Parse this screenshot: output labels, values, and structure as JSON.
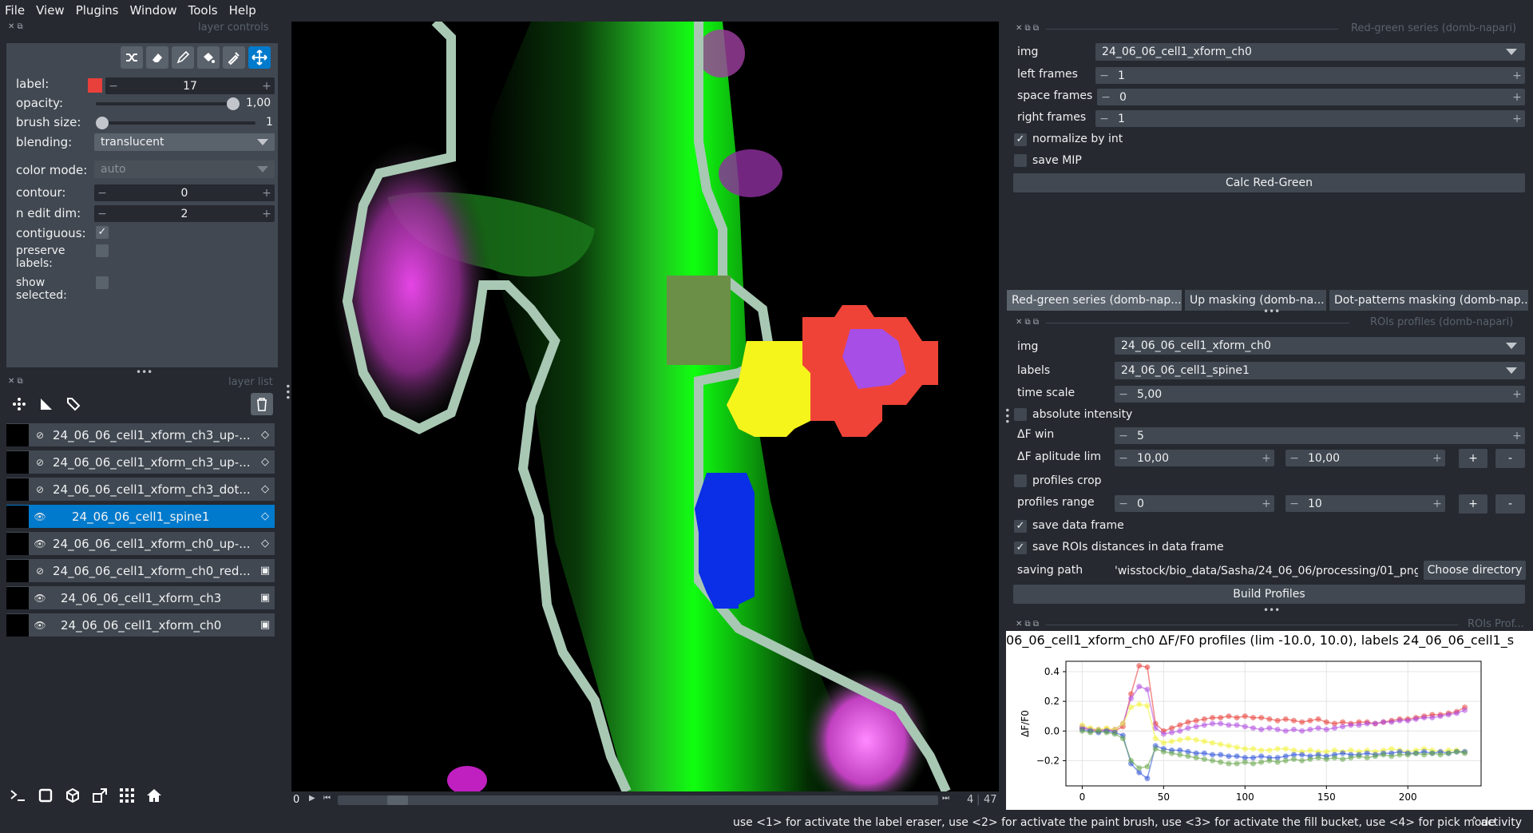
{
  "menu": [
    "File",
    "View",
    "Plugins",
    "Window",
    "Tools",
    "Help"
  ],
  "layer_controls": {
    "title": "layer controls",
    "label_label": "label:",
    "label_value": "17",
    "label_color": "#e8403a",
    "opacity_label": "opacity:",
    "opacity_value": "1,00",
    "opacity_level": 1.0,
    "brush_label": "brush size:",
    "brush_value": "1",
    "brush_level": 0.0,
    "blending_label": "blending:",
    "blending_value": "translucent",
    "colormode_label": "color mode:",
    "colormode_value": "auto",
    "contour_label": "contour:",
    "contour_value": "0",
    "nedit_label": "n edit dim:",
    "nedit_value": "2",
    "contiguous_label": "contiguous:",
    "preserve_label_1": "preserve",
    "preserve_label_2": "labels:",
    "show_label_1": "show",
    "show_label_2": "selected:"
  },
  "layer_list": {
    "title": "layer list",
    "layers": [
      {
        "name": "24_06_06_cell1_xform_ch3_up-...",
        "visible": false,
        "type": "labels-icon"
      },
      {
        "name": "24_06_06_cell1_xform_ch3_up-...",
        "visible": false,
        "type": "labels-icon"
      },
      {
        "name": "24_06_06_cell1_xform_ch3_dot...",
        "visible": false,
        "type": "labels-icon"
      },
      {
        "name": "24_06_06_cell1_spine1",
        "visible": true,
        "type": "labels-icon"
      },
      {
        "name": "24_06_06_cell1_xform_ch0_up-...",
        "visible": true,
        "type": "labels-icon"
      },
      {
        "name": "24_06_06_cell1_xform_ch0_red...",
        "visible": false,
        "type": "image-icon"
      },
      {
        "name": "24_06_06_cell1_xform_ch3",
        "visible": true,
        "type": "image-icon"
      },
      {
        "name": "24_06_06_cell1_xform_ch0",
        "visible": true,
        "type": "image-icon"
      }
    ]
  },
  "viewer": {
    "frame_start": "0",
    "frame_current": "4",
    "frame_total": "47"
  },
  "redgreen": {
    "title": "Red-green series (domb-napari)",
    "img_label": "img",
    "img_value": "24_06_06_cell1_xform_ch0",
    "left_label": "left frames",
    "left_value": "1",
    "space_label": "space frames",
    "space_value": "0",
    "right_label": "right frames",
    "right_value": "1",
    "normalize_label": "normalize by int",
    "savemip_label": "save MIP",
    "calc_button": "Calc Red-Green"
  },
  "tabs": [
    "Red-green series (domb-nap...",
    "Up masking (domb-na...",
    "Dot-patterns masking (domb-nap..."
  ],
  "roi": {
    "title": "ROIs profiles (domb-napari)",
    "img_label": "img",
    "img_value": "24_06_06_cell1_xform_ch0",
    "labels_label": "labels",
    "labels_value": "24_06_06_cell1_spine1",
    "timescale_label": "time scale",
    "timescale_value": "5,00",
    "absint_label": "absolute intensity",
    "dfwin_label": "ΔF win",
    "dfwin_value": "5",
    "dflim_label": "ΔF aplitude lim",
    "dflim_min": "10,00",
    "dflim_max": "10,00",
    "crop_label": "profiles crop",
    "range_label": "profiles range",
    "range_min": "0",
    "range_max": "10",
    "savedf_label": "save data frame",
    "savedist_label": "save ROIs distances in data frame",
    "path_label": "saving path",
    "path_value": "'wisstock/bio_data/Sasha/24_06_06/processing/01_png",
    "choose_button": "Choose directory",
    "build_button": "Build Profiles"
  },
  "plot_panel_title": "ROIs Prof...",
  "chart_data": {
    "type": "line",
    "title": "06_06_cell1_xform_ch0 ΔF/F0 profiles (lim -10.0, 10.0), labels 24_06_06_cell1_s",
    "ylabel": "ΔF/F0",
    "xlabel": "",
    "xlim": [
      -10,
      245
    ],
    "ylim": [
      -0.37,
      0.47
    ],
    "xticks": [
      0,
      50,
      100,
      150,
      200
    ],
    "yticks": [
      -0.2,
      0.0,
      0.2,
      0.4
    ],
    "grid": true,
    "series": [
      {
        "color": "#e8403a",
        "x": [
          0,
          5,
          10,
          15,
          20,
          25,
          30,
          35,
          40,
          45,
          50,
          55,
          60,
          65,
          70,
          75,
          80,
          85,
          90,
          95,
          100,
          105,
          110,
          115,
          120,
          125,
          130,
          135,
          140,
          145,
          150,
          155,
          160,
          165,
          170,
          175,
          180,
          185,
          190,
          195,
          200,
          205,
          210,
          215,
          220,
          225,
          230,
          235
        ],
        "values": [
          0.02,
          0.01,
          0.0,
          0.01,
          0.0,
          0.03,
          0.25,
          0.44,
          0.43,
          0.05,
          0.0,
          0.02,
          0.04,
          0.06,
          0.07,
          0.08,
          0.09,
          0.09,
          0.1,
          0.09,
          0.1,
          0.09,
          0.09,
          0.08,
          0.07,
          0.08,
          0.07,
          0.06,
          0.07,
          0.08,
          0.06,
          0.05,
          0.06,
          0.05,
          0.06,
          0.06,
          0.05,
          0.06,
          0.07,
          0.08,
          0.08,
          0.09,
          0.1,
          0.11,
          0.11,
          0.12,
          0.13,
          0.16
        ]
      },
      {
        "color": "#b04ee0",
        "x": [
          0,
          5,
          10,
          15,
          20,
          25,
          30,
          35,
          40,
          45,
          50,
          55,
          60,
          65,
          70,
          75,
          80,
          85,
          90,
          95,
          100,
          105,
          110,
          115,
          120,
          125,
          130,
          135,
          140,
          145,
          150,
          155,
          160,
          165,
          170,
          175,
          180,
          185,
          190,
          195,
          200,
          205,
          210,
          215,
          220,
          225,
          230,
          235
        ],
        "values": [
          0.03,
          0.01,
          0.01,
          0.0,
          0.01,
          0.05,
          0.22,
          0.3,
          0.28,
          0.02,
          -0.02,
          -0.01,
          0.0,
          0.02,
          0.03,
          0.04,
          0.05,
          0.05,
          0.04,
          0.04,
          0.03,
          0.02,
          0.01,
          0.02,
          0.01,
          0.0,
          0.01,
          0.0,
          0.01,
          0.02,
          0.01,
          0.02,
          0.03,
          0.04,
          0.04,
          0.05,
          0.05,
          0.06,
          0.06,
          0.07,
          0.07,
          0.08,
          0.09,
          0.09,
          0.1,
          0.11,
          0.12,
          0.14
        ]
      },
      {
        "color": "#f2f23a",
        "x": [
          0,
          5,
          10,
          15,
          20,
          25,
          30,
          35,
          40,
          45,
          50,
          55,
          60,
          65,
          70,
          75,
          80,
          85,
          90,
          95,
          100,
          105,
          110,
          115,
          120,
          125,
          130,
          135,
          140,
          145,
          150,
          155,
          160,
          165,
          170,
          175,
          180,
          185,
          190,
          195,
          200,
          205,
          210,
          215,
          220,
          225,
          230,
          235
        ],
        "values": [
          0.04,
          0.02,
          0.01,
          0.02,
          0.01,
          0.05,
          0.16,
          0.18,
          0.17,
          -0.05,
          -0.08,
          -0.07,
          -0.06,
          -0.05,
          -0.06,
          -0.07,
          -0.08,
          -0.09,
          -0.1,
          -0.11,
          -0.12,
          -0.12,
          -0.13,
          -0.13,
          -0.12,
          -0.12,
          -0.13,
          -0.14,
          -0.13,
          -0.14,
          -0.14,
          -0.13,
          -0.14,
          -0.13,
          -0.14,
          -0.13,
          -0.14,
          -0.13,
          -0.12,
          -0.13,
          -0.14,
          -0.13,
          -0.12,
          -0.13,
          -0.14,
          -0.13,
          -0.13,
          -0.14
        ]
      },
      {
        "color": "#2f54d8",
        "x": [
          0,
          5,
          10,
          15,
          20,
          25,
          30,
          35,
          40,
          45,
          50,
          55,
          60,
          65,
          70,
          75,
          80,
          85,
          90,
          95,
          100,
          105,
          110,
          115,
          120,
          125,
          130,
          135,
          140,
          145,
          150,
          155,
          160,
          165,
          170,
          175,
          180,
          185,
          190,
          195,
          200,
          205,
          210,
          215,
          220,
          225,
          230,
          235
        ],
        "values": [
          0.01,
          0.0,
          -0.01,
          0.0,
          -0.01,
          -0.03,
          -0.22,
          -0.28,
          -0.32,
          -0.1,
          -0.12,
          -0.13,
          -0.13,
          -0.14,
          -0.15,
          -0.15,
          -0.16,
          -0.16,
          -0.17,
          -0.17,
          -0.18,
          -0.18,
          -0.17,
          -0.18,
          -0.18,
          -0.17,
          -0.16,
          -0.16,
          -0.17,
          -0.16,
          -0.17,
          -0.16,
          -0.15,
          -0.16,
          -0.16,
          -0.15,
          -0.16,
          -0.15,
          -0.15,
          -0.14,
          -0.15,
          -0.15,
          -0.14,
          -0.15,
          -0.14,
          -0.15,
          -0.14,
          -0.14
        ]
      },
      {
        "color": "#6aa84f",
        "x": [
          0,
          5,
          10,
          15,
          20,
          25,
          30,
          35,
          40,
          45,
          50,
          55,
          60,
          65,
          70,
          75,
          80,
          85,
          90,
          95,
          100,
          105,
          110,
          115,
          120,
          125,
          130,
          135,
          140,
          145,
          150,
          155,
          160,
          165,
          170,
          175,
          180,
          185,
          190,
          195,
          200,
          205,
          210,
          215,
          220,
          225,
          230,
          235
        ],
        "values": [
          0.0,
          -0.01,
          0.0,
          -0.01,
          -0.02,
          -0.05,
          -0.2,
          -0.25,
          -0.24,
          -0.12,
          -0.14,
          -0.15,
          -0.16,
          -0.17,
          -0.18,
          -0.19,
          -0.2,
          -0.21,
          -0.22,
          -0.22,
          -0.21,
          -0.22,
          -0.21,
          -0.2,
          -0.21,
          -0.2,
          -0.19,
          -0.2,
          -0.19,
          -0.18,
          -0.19,
          -0.18,
          -0.19,
          -0.18,
          -0.17,
          -0.18,
          -0.17,
          -0.16,
          -0.17,
          -0.16,
          -0.16,
          -0.15,
          -0.16,
          -0.15,
          -0.16,
          -0.15,
          -0.14,
          -0.15
        ]
      }
    ]
  },
  "status": {
    "hint": "use <1> for activate the label eraser, use <2> for activate the paint brush, use <3> for activate the fill bucket, use <4> for pick mode",
    "activity": "activity"
  }
}
